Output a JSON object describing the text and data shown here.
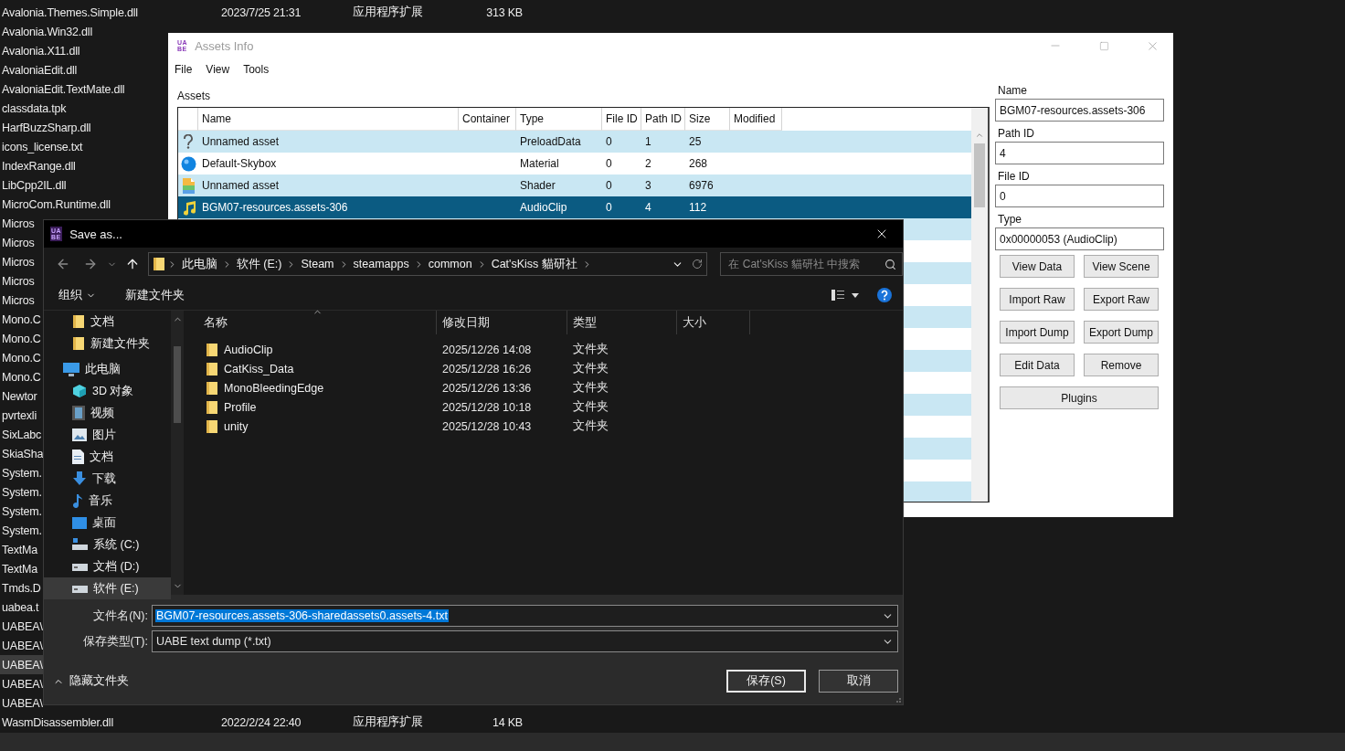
{
  "background_files": [
    {
      "name": "Avalonia.Themes.Simple.dll",
      "date": "2023/7/25 21:31",
      "type": "应用程序扩展",
      "size": "313 KB",
      "selected": false
    },
    {
      "name": "Avalonia.Win32.dll",
      "selected": false
    },
    {
      "name": "Avalonia.X11.dll",
      "selected": false
    },
    {
      "name": "AvaloniaEdit.dll",
      "selected": false
    },
    {
      "name": "AvaloniaEdit.TextMate.dll",
      "selected": false
    },
    {
      "name": "classdata.tpk",
      "selected": false
    },
    {
      "name": "HarfBuzzSharp.dll",
      "selected": false
    },
    {
      "name": "icons_license.txt",
      "selected": false
    },
    {
      "name": "IndexRange.dll",
      "selected": false
    },
    {
      "name": "LibCpp2IL.dll",
      "selected": false
    },
    {
      "name": "MicroCom.Runtime.dll",
      "selected": false
    },
    {
      "name": "Micros",
      "selected": false
    },
    {
      "name": "Micros",
      "selected": false
    },
    {
      "name": "Micros",
      "selected": false
    },
    {
      "name": "Micros",
      "selected": false
    },
    {
      "name": "Micros",
      "selected": false
    },
    {
      "name": "Mono.C",
      "selected": false
    },
    {
      "name": "Mono.C",
      "selected": false
    },
    {
      "name": "Mono.C",
      "selected": false
    },
    {
      "name": "Mono.C",
      "selected": false
    },
    {
      "name": "Newtor",
      "selected": false
    },
    {
      "name": "pvrtexli",
      "selected": false
    },
    {
      "name": "SixLabc",
      "selected": false
    },
    {
      "name": "SkiaSha",
      "selected": false
    },
    {
      "name": "System.",
      "selected": false
    },
    {
      "name": "System.",
      "selected": false
    },
    {
      "name": "System.",
      "selected": false
    },
    {
      "name": "System.",
      "selected": false
    },
    {
      "name": "TextMa",
      "selected": false
    },
    {
      "name": "TextMa",
      "selected": false
    },
    {
      "name": "Tmds.D",
      "selected": false
    },
    {
      "name": "uabea.t",
      "selected": false
    },
    {
      "name": "UABEA\\",
      "selected": false
    },
    {
      "name": "UABEA\\",
      "selected": false
    },
    {
      "name": "UABEA\\",
      "selected": true
    },
    {
      "name": "UABEA\\",
      "selected": false
    },
    {
      "name": "UABEA\\",
      "selected": false
    },
    {
      "name": "WasmDisassembler.dll",
      "date": "2022/2/24 22:40",
      "type": "应用程序扩展",
      "size": "14 KB",
      "selected": false
    }
  ],
  "assets_window": {
    "icon_letters": [
      "UA",
      "BE"
    ],
    "title": "Assets Info",
    "menu": [
      "File",
      "View",
      "Tools"
    ],
    "section_label": "Assets",
    "table": {
      "columns": [
        "Name",
        "Container",
        "Type",
        "File ID",
        "Path ID",
        "Size",
        "Modified"
      ],
      "rows": [
        {
          "kind": "unknown",
          "name": "Unnamed asset",
          "type": "PreloadData",
          "file_id": "0",
          "path_id": "1",
          "size": "25",
          "selected": false
        },
        {
          "kind": "material",
          "name": "Default-Skybox",
          "type": "Material",
          "file_id": "0",
          "path_id": "2",
          "size": "268",
          "selected": false
        },
        {
          "kind": "shader",
          "name": "Unnamed asset",
          "type": "Shader",
          "file_id": "0",
          "path_id": "3",
          "size": "6976",
          "selected": false
        },
        {
          "kind": "audio",
          "name": "BGM07-resources.assets-306",
          "type": "AudioClip",
          "file_id": "0",
          "path_id": "4",
          "size": "112",
          "selected": true
        }
      ]
    },
    "details": [
      {
        "label": "Name",
        "value": "BGM07-resources.assets-306"
      },
      {
        "label": "Path ID",
        "value": "4"
      },
      {
        "label": "File ID",
        "value": "0"
      },
      {
        "label": "Type",
        "value": "0x00000053 (AudioClip)"
      }
    ],
    "buttons": [
      "View Data",
      "View Scene",
      "Import Raw",
      "Export Raw",
      "Import Dump",
      "Export Dump",
      "Edit Data",
      "Remove"
    ],
    "wide_button": "Plugins"
  },
  "save_dialog": {
    "icon_letters": [
      "UA",
      "BE"
    ],
    "title": "Save as...",
    "breadcrumb": [
      "此电脑",
      "软件 (E:)",
      "Steam",
      "steamapps",
      "common",
      "Cat'sKiss 貓研社"
    ],
    "search": {
      "placeholder": "在 Cat'sKiss 貓研社 中搜索"
    },
    "organize": "组织",
    "new_folder": "新建文件夹",
    "pinned": [
      {
        "label": "文档",
        "kind": "folder",
        "selected": false
      },
      {
        "label": "新建文件夹",
        "kind": "folder",
        "selected": false
      }
    ],
    "computer": {
      "label": "此电脑",
      "children": [
        {
          "label": "3D 对象",
          "kind": "cube",
          "selected": false
        },
        {
          "label": "视频",
          "kind": "video",
          "selected": false
        },
        {
          "label": "图片",
          "kind": "picture",
          "selected": false
        },
        {
          "label": "文档",
          "kind": "document",
          "selected": false
        },
        {
          "label": "下载",
          "kind": "download",
          "selected": false
        },
        {
          "label": "音乐",
          "kind": "music",
          "selected": false
        },
        {
          "label": "桌面",
          "kind": "desktop",
          "selected": false
        },
        {
          "label": "系统 (C:)",
          "kind": "system-drive",
          "selected": false
        },
        {
          "label": "文档 (D:)",
          "kind": "drive",
          "selected": false
        },
        {
          "label": "软件 (E:)",
          "kind": "drive",
          "selected": true
        }
      ]
    },
    "columns": [
      "名称",
      "修改日期",
      "类型",
      "大小"
    ],
    "files": [
      {
        "name": "AudioClip",
        "date": "2025/12/26 14:08",
        "type": "文件夹"
      },
      {
        "name": "CatKiss_Data",
        "date": "2025/12/28 16:26",
        "type": "文件夹"
      },
      {
        "name": "MonoBleedingEdge",
        "date": "2025/12/26 13:36",
        "type": "文件夹"
      },
      {
        "name": "Profile",
        "date": "2025/12/28 10:18",
        "type": "文件夹"
      },
      {
        "name": "unity",
        "date": "2025/12/28 10:43",
        "type": "文件夹"
      }
    ],
    "filename": {
      "label": "文件名(N):",
      "value": "BGM07-resources.assets-306-sharedassets0.assets-4.txt"
    },
    "filetype": {
      "label": "保存类型(T):",
      "value": "UABE text dump (*.txt)"
    },
    "hide_folders": "隐藏文件夹",
    "buttons": [
      {
        "label": "保存(S)",
        "focused": true
      },
      {
        "label": "取消",
        "focused": false
      }
    ]
  }
}
